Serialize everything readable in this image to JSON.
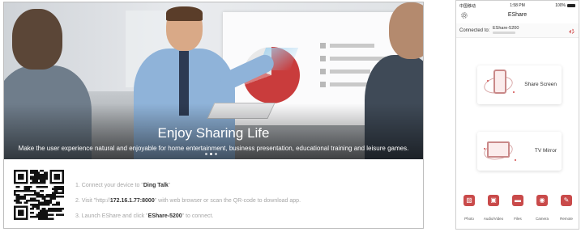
{
  "tv": {
    "banner": {
      "headline": "Enjoy Sharing Life",
      "subline": "Make the user experience natural and enjoyable for home entertainment, business presentation, educational training and leisure games.",
      "slide_count": 3,
      "active_slide": 2
    },
    "steps": [
      {
        "prefix": "1. Connect your device to \"",
        "bold": "Ding Talk",
        "suffix": "\""
      },
      {
        "prefix": "2. Visit \"http://",
        "bold": "172.16.1.77:8000",
        "suffix": "\" with web browser or scan the QR-code to download app."
      },
      {
        "prefix": "3. Launch EShare and click \"",
        "bold": "EShare-5200",
        "suffix": "\" to connect."
      }
    ]
  },
  "phone": {
    "statusbar": {
      "carrier": "中国移动",
      "time": "1:58 PM",
      "battery": "100%"
    },
    "title": "EShare",
    "connection": {
      "label": "Connected to:",
      "device": "EShare-5200"
    },
    "cards": {
      "share_screen": "Share Screen",
      "tv_mirror": "TV Mirror"
    },
    "tabs": [
      {
        "label": "Photo",
        "icon": "photo-icon"
      },
      {
        "label": "Audio/Video",
        "icon": "audio-video-icon"
      },
      {
        "label": "Files",
        "icon": "files-icon"
      },
      {
        "label": "Camera",
        "icon": "camera-icon"
      },
      {
        "label": "Remote",
        "icon": "remote-icon"
      }
    ],
    "accent_color": "#c94a4a"
  }
}
